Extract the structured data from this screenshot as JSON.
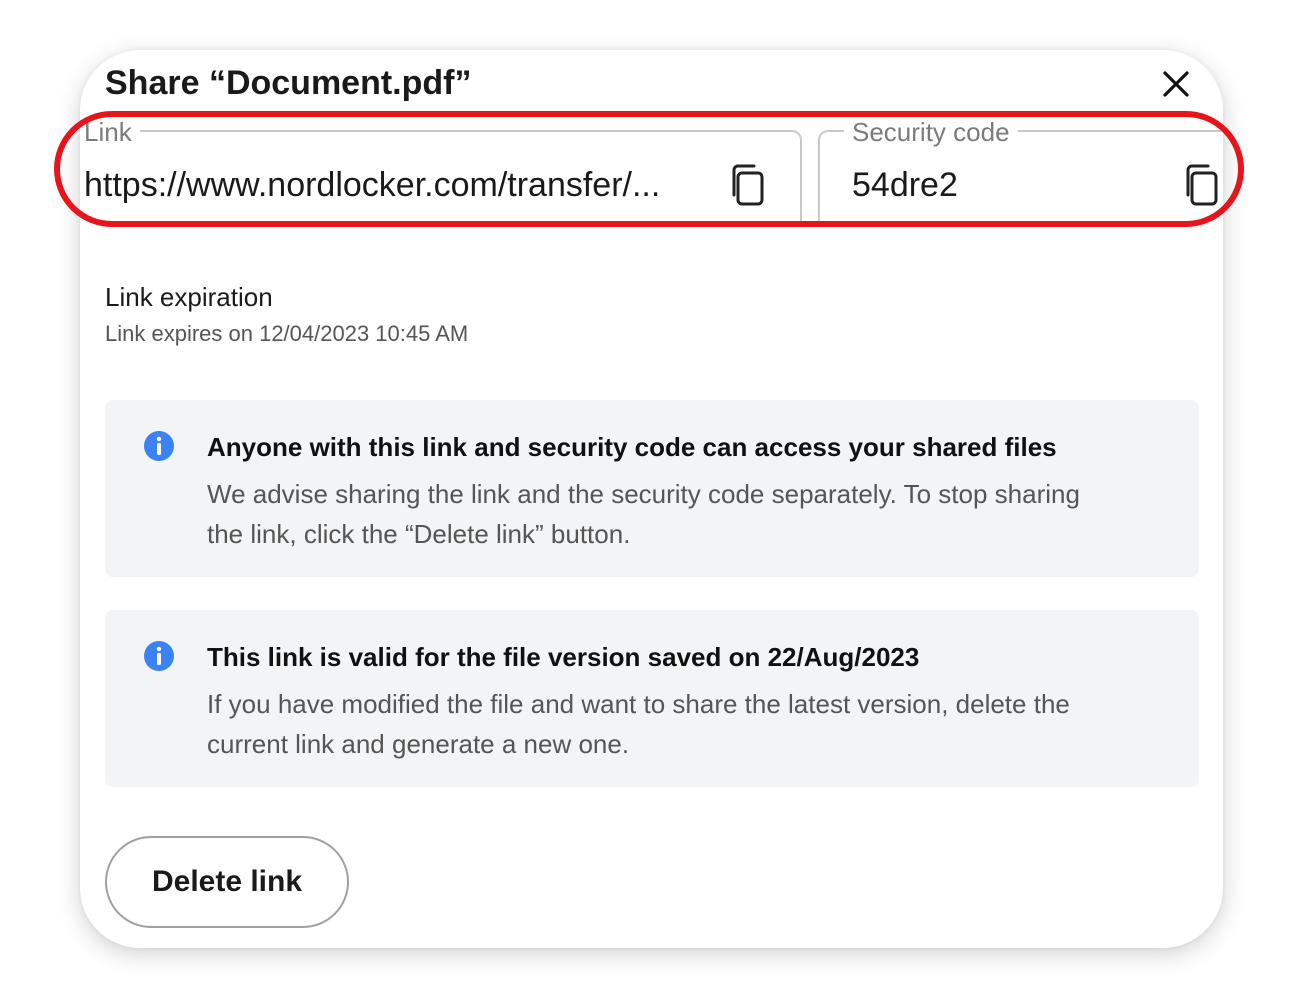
{
  "dialog": {
    "title": "Share “Document.pdf”",
    "close_icon": "close-icon"
  },
  "link_field": {
    "label": "Link",
    "value": "https://www.nordlocker.com/transfer/...",
    "copy_icon": "copy-icon"
  },
  "security_field": {
    "label": "Security code",
    "value": "54dre2",
    "copy_icon": "copy-icon"
  },
  "expiration": {
    "title": "Link expiration",
    "subtitle": "Link expires on 12/04/2023 10:45 AM"
  },
  "info_boxes": [
    {
      "icon": "info-icon",
      "heading": "Anyone with this link and security code can access your shared files",
      "body": "We advise sharing the link and the security code separately. To stop sharing the link, click the “Delete link” button."
    },
    {
      "icon": "info-icon",
      "heading": "This link is valid for the file version saved on 22/Aug/2023",
      "body": "If you have modified the file and want to share the latest version, delete the current link and generate a new one."
    }
  ],
  "delete_button": {
    "label": "Delete link"
  },
  "colors": {
    "highlight": "#e8141c",
    "info_icon": "#3b82f6",
    "info_box_bg": "#f3f4f5"
  }
}
